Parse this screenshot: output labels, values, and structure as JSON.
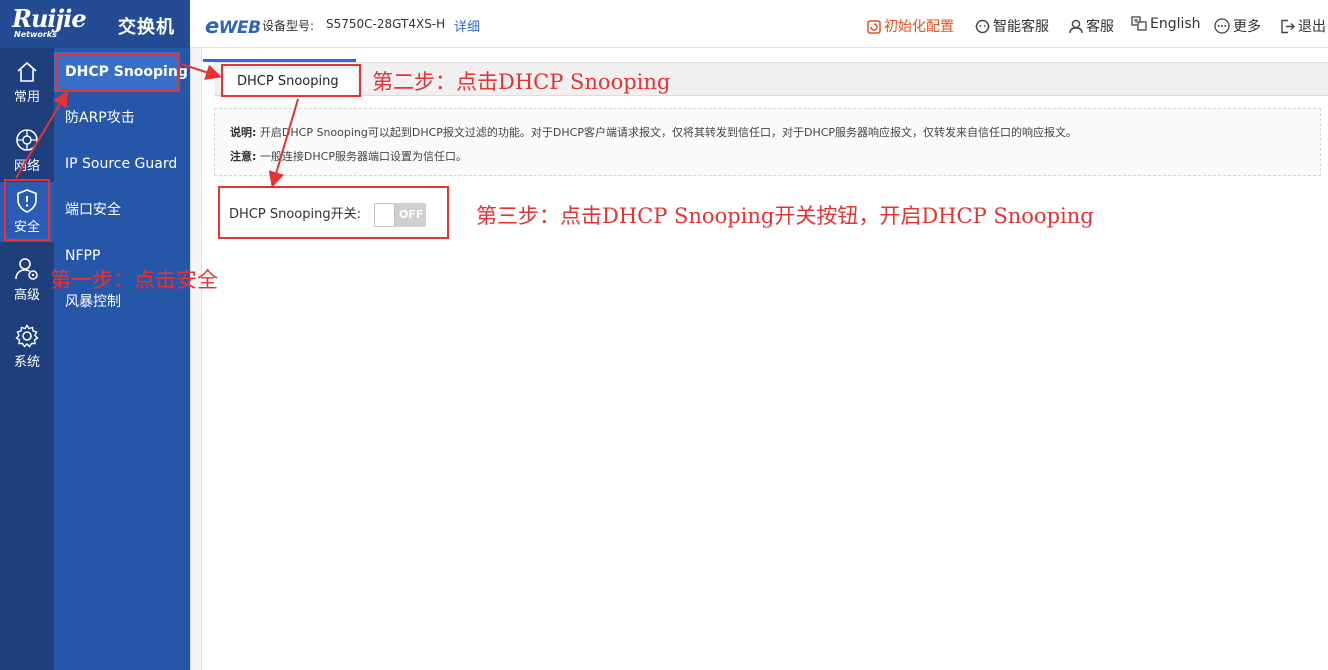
{
  "brand": {
    "logo_text": "Ruijie",
    "logo_sub": "Networks",
    "app_title": "交换机"
  },
  "header": {
    "eweb_e": "e",
    "eweb_text": "WEB",
    "model_label": "设备型号:",
    "model_value": "S5750C-28GT4XS-H",
    "detail_link": "详细",
    "actions": {
      "init": "初始化配置",
      "smart_service": "智能客服",
      "service": "客服",
      "language": "English",
      "more": "更多",
      "logout": "退出"
    }
  },
  "rail": {
    "items": [
      {
        "label": "常用",
        "icon": "home-icon"
      },
      {
        "label": "网络",
        "icon": "network-globe-icon"
      },
      {
        "label": "安全",
        "icon": "shield-alert-icon"
      },
      {
        "label": "高级",
        "icon": "user-settings-icon"
      },
      {
        "label": "系统",
        "icon": "gear-icon"
      }
    ]
  },
  "submenu": {
    "items": [
      {
        "label": "DHCP Snooping"
      },
      {
        "label": "防ARP攻击"
      },
      {
        "label": "IP Source Guard"
      },
      {
        "label": "端口安全"
      },
      {
        "label": "NFPP"
      },
      {
        "label": "风暴控制"
      }
    ]
  },
  "content": {
    "tab_label": "DHCP Snooping",
    "note_line1_label": "说明:",
    "note_line1_text": "开启DHCP Snooping可以起到DHCP报文过滤的功能。对于DHCP客户端请求报文，仅将其转发到信任口，对于DHCP服务器响应报文，仅转发来自信任口的响应报文。",
    "note_line2_label": "注意:",
    "note_line2_text": "一般连接DHCP服务器端口设置为信任口。",
    "switch_label": "DHCP Snooping开关:",
    "switch_state": "OFF"
  },
  "annotations": {
    "step1": "第一步：点击安全",
    "step2": "第二步：点击DHCP Snooping",
    "step3": "第三步：点击DHCP Snooping开关按钮，开启DHCP Snooping",
    "color": "#e53333"
  },
  "colors": {
    "rail_bg": "#1e3f7c",
    "submenu_bg": "#2656a8",
    "accent": "#2f6bd4",
    "init_orange": "#e8501f"
  }
}
